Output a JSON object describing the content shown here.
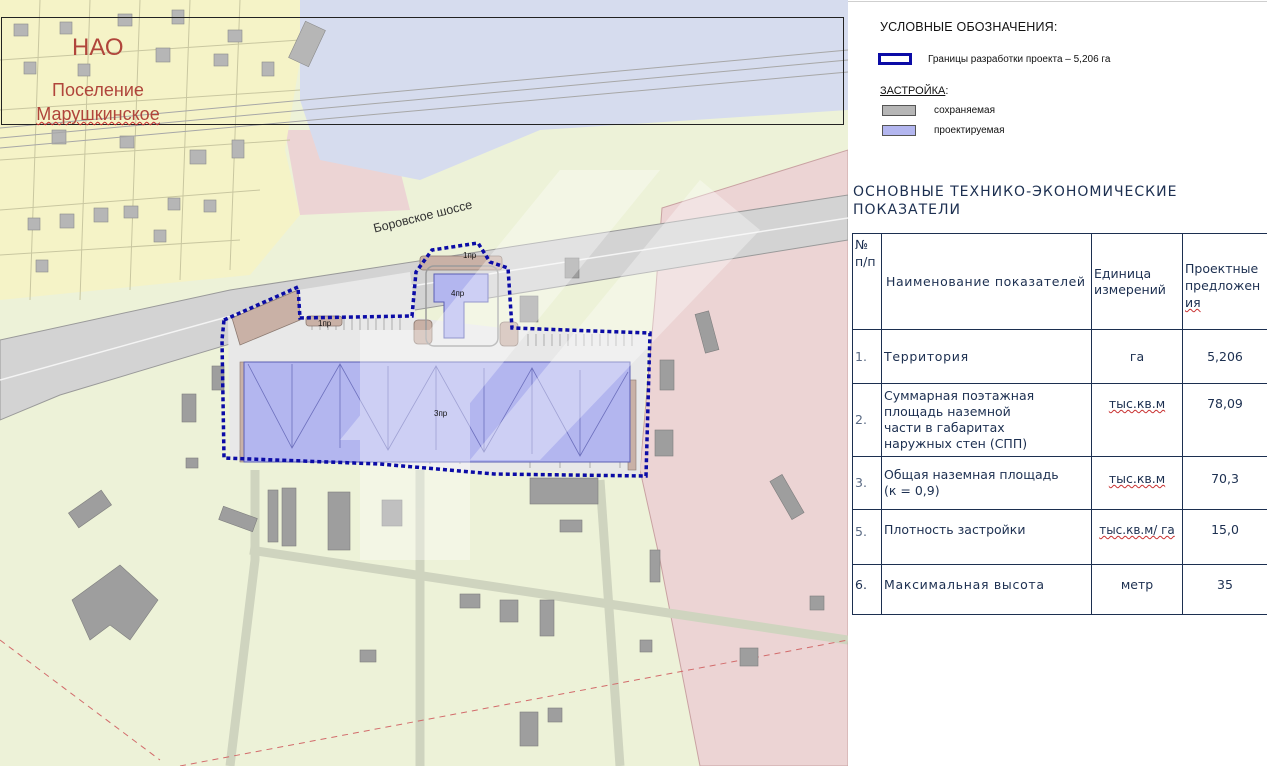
{
  "map": {
    "district": "НАО",
    "settlement_line1": "Поселение",
    "settlement_line2": "Марушкинское",
    "road_name": "Боровское шоссе",
    "building_labels": [
      "1пр",
      "4пр",
      "1пр",
      "3пр"
    ],
    "colors": {
      "project_border": "#0b0ba6",
      "kept_building": "#b6b6b6",
      "planned_building": "#b3b6ef",
      "residential_zone": "#f5f3c7",
      "industrial_zone": "#edf2d8",
      "road": "#d3d3d3",
      "pink_zone": "#ecd4d4"
    }
  },
  "legend": {
    "title": "УСЛОВНЫЕ ОБОЗНАЧЕНИЯ:",
    "border_label": "Границы разработки проекта – 5,206 га",
    "development_heading": "ЗАСТРОЙКА",
    "development_colon": ":",
    "kept_label": "сохраняемая",
    "planned_label": "проектируемая"
  },
  "indicators": {
    "title": "ОСНОВНЫЕ ТЕХНИКО-ЭКОНОМИЧЕСКИЕ ПОКАЗАТЕЛИ",
    "headers": {
      "num_line1": "№",
      "num_line2": "п/п",
      "name": "Наименование показателей",
      "unit": "Единица измерений",
      "value_line1": "Проектные",
      "value_line2": "предложен",
      "value_line3": "ия"
    },
    "rows": [
      {
        "num": "1.",
        "name": "Территория",
        "unit": "га",
        "value": "5,206"
      },
      {
        "num": "2.",
        "name_line1": "Суммарная поэтажная",
        "name_line2": "площадь наземной",
        "name_line3": "части в габаритах",
        "name_line4": "наружных стен (СПП)",
        "unit": "тыс.кв.м",
        "value": "78,09"
      },
      {
        "num": "3.",
        "name_line1": "Общая наземная площадь",
        "name_line2": "(к = 0,9)",
        "unit": "тыс.кв.м",
        "value": "70,3"
      },
      {
        "num": "5.",
        "name": "Плотность застройки",
        "unit": "тыс.кв.м/ га",
        "value": "15,0"
      },
      {
        "num": "6.",
        "name": "Максимальная высота",
        "unit": "метр",
        "value": "35"
      }
    ]
  }
}
